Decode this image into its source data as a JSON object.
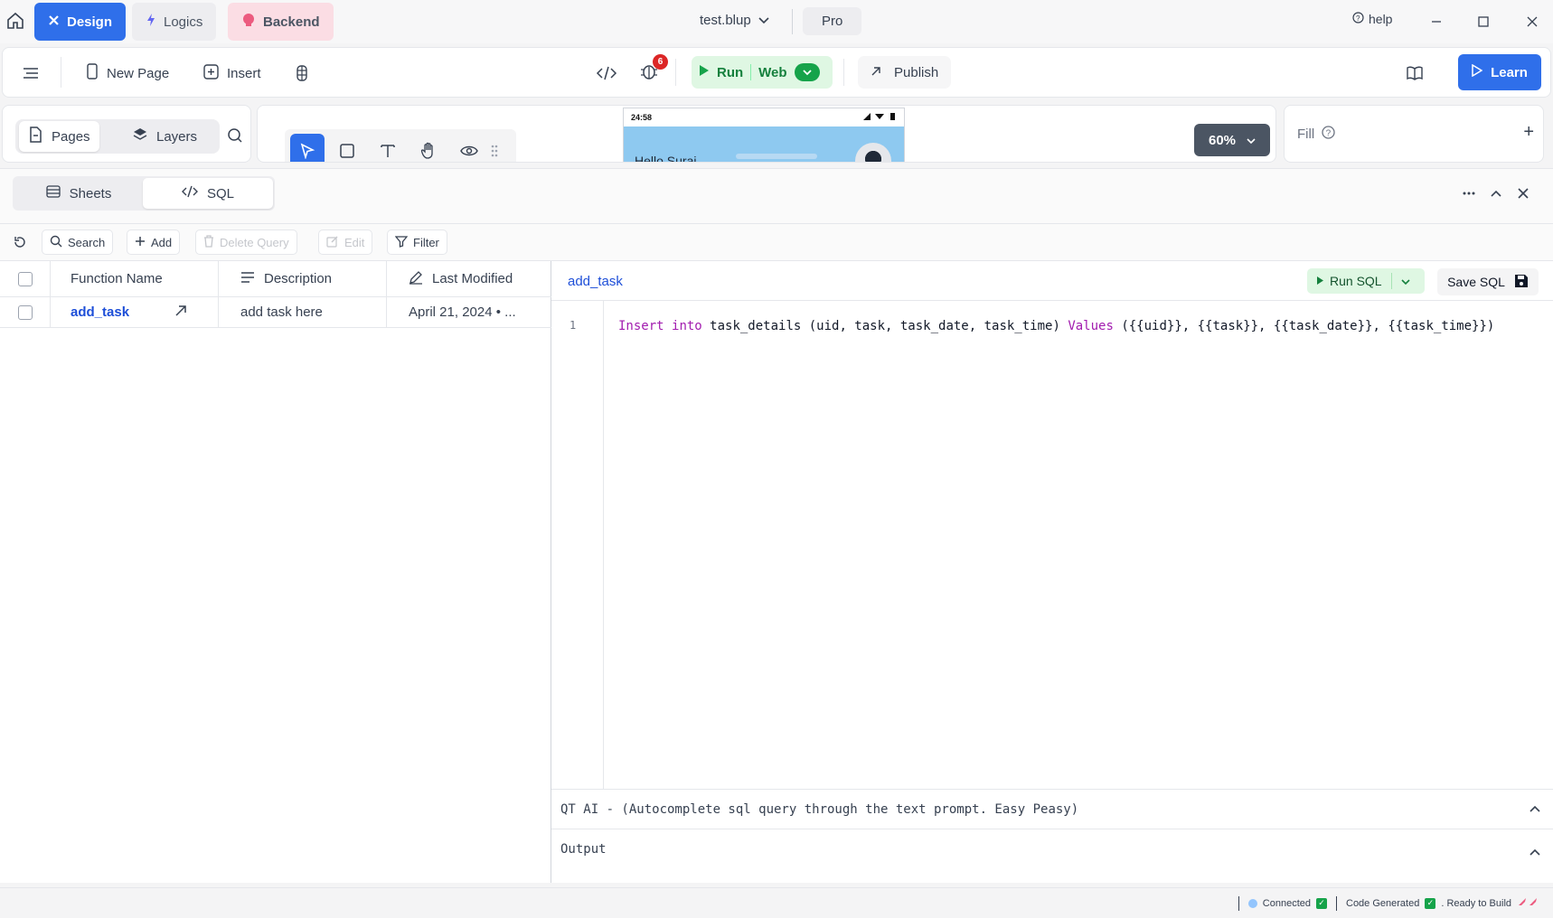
{
  "titlebar": {
    "modes": [
      {
        "label": "Design",
        "icon": "design-icon"
      },
      {
        "label": "Logics",
        "icon": "lightning-icon"
      },
      {
        "label": "Backend",
        "icon": "backend-icon"
      }
    ],
    "file_name": "test.blup",
    "plan_badge": "Pro",
    "help_label": "help"
  },
  "toolbar": {
    "new_page_label": "New Page",
    "insert_label": "Insert",
    "bug_count": "6",
    "run_label": "Run",
    "platform_label": "Web",
    "publish_label": "Publish",
    "learn_label": "Learn"
  },
  "left_panel": {
    "tabs": [
      {
        "label": "Pages"
      },
      {
        "label": "Layers"
      }
    ]
  },
  "canvas": {
    "phone_time": "24:58",
    "phone_greeting": "Hello Suraj",
    "zoom_level": "60%"
  },
  "properties": {
    "fill_label": "Fill"
  },
  "backend": {
    "tabs": [
      {
        "label": "Sheets",
        "icon": "sheets-icon"
      },
      {
        "label": "SQL",
        "icon": "code-icon"
      }
    ],
    "query_actions": {
      "search": "Search",
      "add": "Add",
      "delete": "Delete Query",
      "edit": "Edit",
      "filter": "Filter"
    },
    "table": {
      "columns": [
        "Function Name",
        "Description",
        "Last Modified"
      ],
      "rows": [
        {
          "function_name": "add_task",
          "description": "add task here",
          "last_modified": "April 21, 2024 • ..."
        }
      ]
    },
    "editor": {
      "title": "add_task",
      "run_sql_label": "Run SQL",
      "save_sql_label": "Save SQL",
      "line_number": "1",
      "code_tokens": {
        "kw_insert": "Insert",
        "kw_into": "into",
        "middle": " task_details (uid, task, task_date, task_time) ",
        "kw_values": "Values",
        "tail": " ({{uid}}, {{task}}, {{task_date}}, {{task_time}})"
      },
      "ai_panel_label": "QT AI - (Autocomplete sql query through the text prompt. Easy Peasy)",
      "output_label": "Output"
    }
  },
  "statusbar": {
    "connected": "Connected",
    "code_generated": "Code Generated",
    "ready": ". Ready to Build"
  },
  "colors": {
    "accent": "#2f6fea",
    "run_green": "#16a34a",
    "keyword": "#a21caf"
  }
}
